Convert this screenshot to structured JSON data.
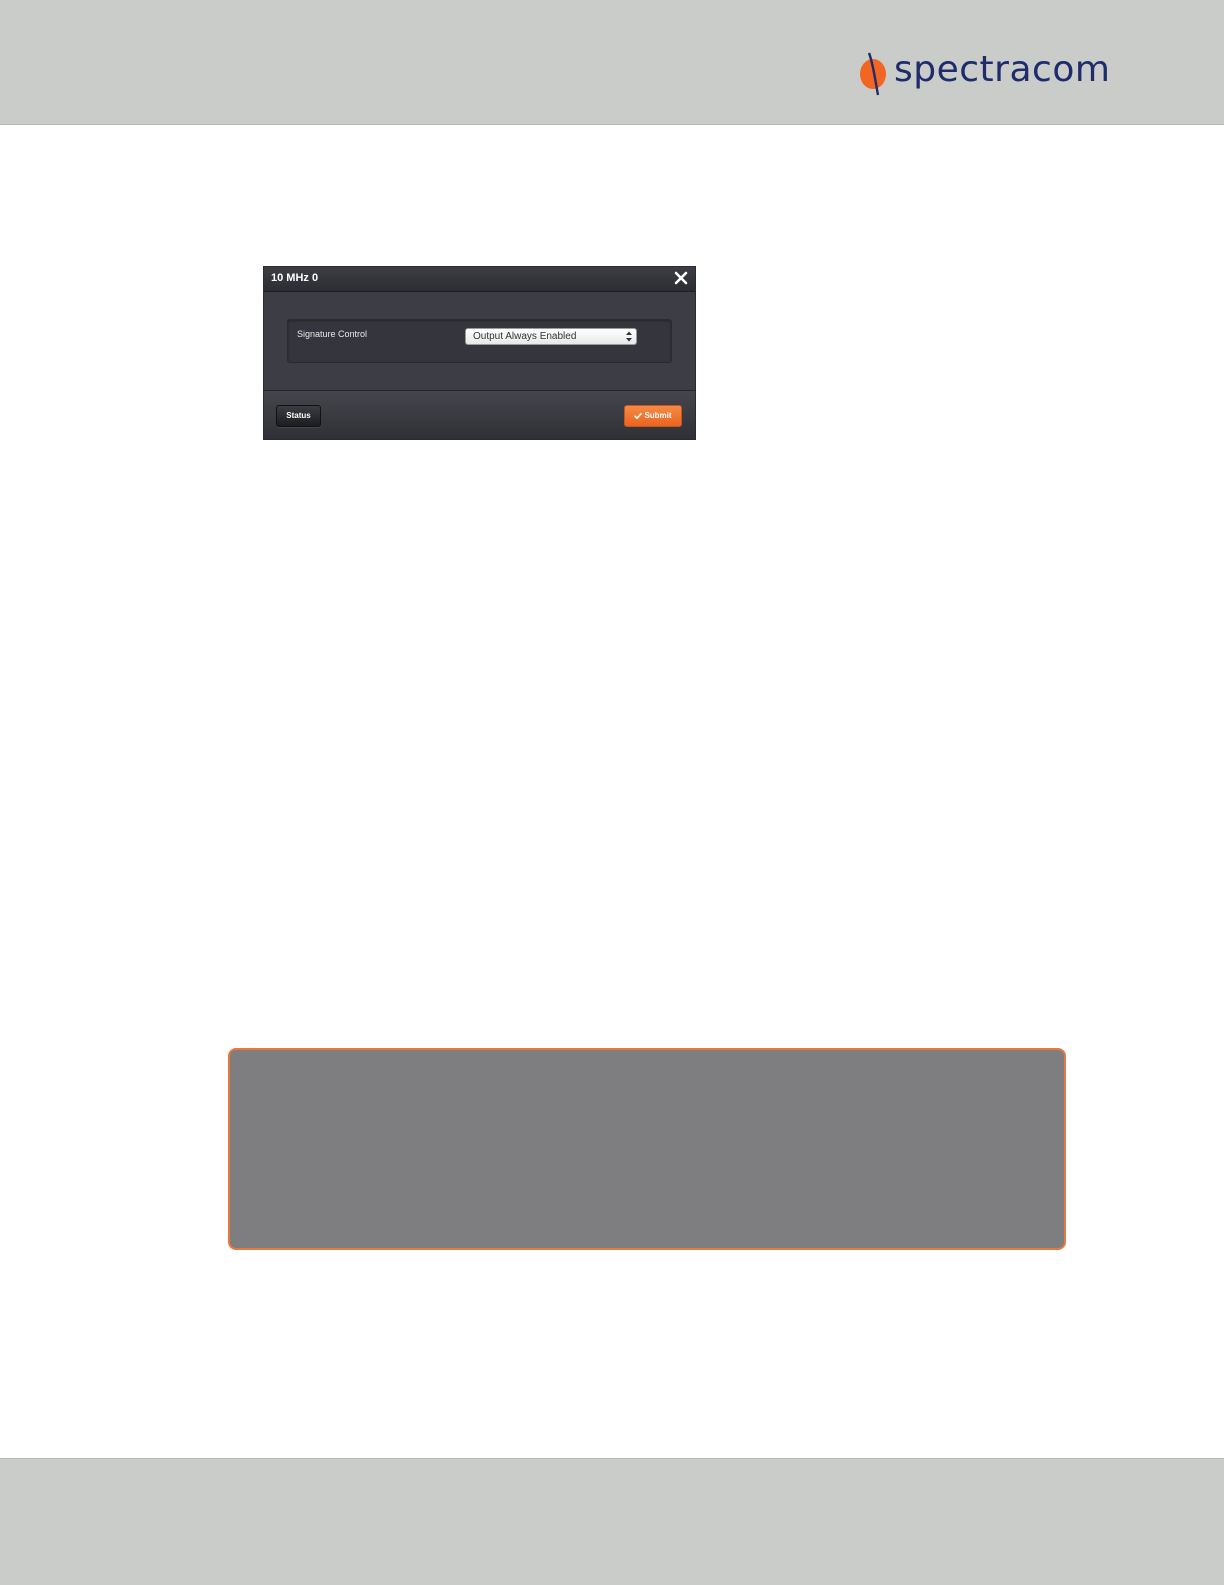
{
  "brand": {
    "name": "spectracom",
    "mark_color": "#f26522",
    "text_color": "#1f2c6b"
  },
  "dialog": {
    "title": "10 MHz 0",
    "close_icon": "close-icon",
    "field": {
      "label": "Signature Control",
      "selected_value": "Output Always Enabled"
    },
    "buttons": {
      "status_label": "Status",
      "submit_label": "Submit",
      "submit_icon": "check-icon"
    },
    "accent_color": "#f26522"
  },
  "note": {
    "border_color": "#e8793d",
    "fill_color": "#7e7d7f"
  }
}
